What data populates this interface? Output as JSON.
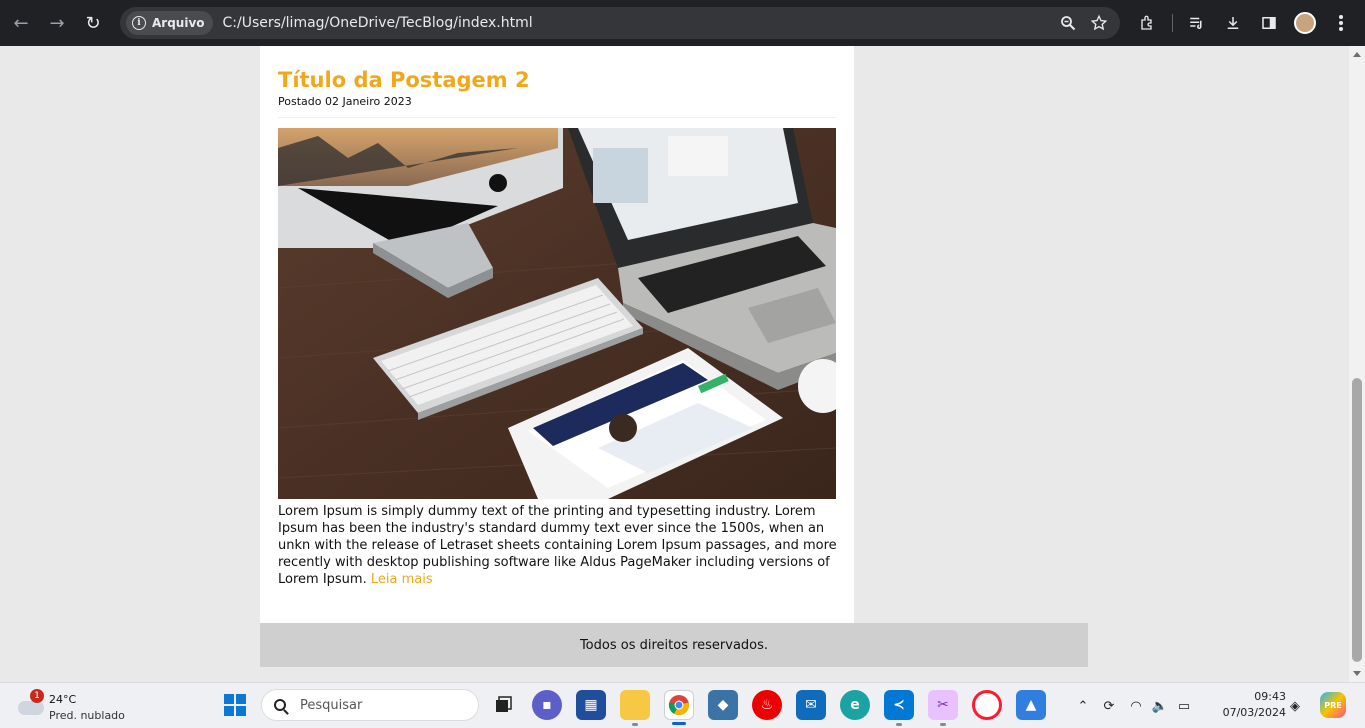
{
  "browser": {
    "nav": {
      "back": "←",
      "forward": "→",
      "reload": "↻"
    },
    "chip_label": "Arquivo",
    "url": "C:/Users/limag/OneDrive/TecBlog/index.html",
    "icons": [
      "zoom-icon",
      "bookmark-star-icon",
      "extensions-icon",
      "reading-list-icon",
      "download-icon",
      "side-panel-icon",
      "profile-avatar",
      "menu-kebab-icon"
    ]
  },
  "post": {
    "title": "Título da Postagem 2",
    "date": "Postado 02 Janeiro 2023",
    "image_alt": "Desk with iMac, MacBook, keyboard and tablet",
    "body": "Lorem Ipsum is simply dummy text of the printing and typesetting industry. Lorem Ipsum has been the industry's standard dummy text ever since the 1500s, when an unkn with the release of Letraset sheets containing Lorem Ipsum passages, and more recently with desktop publishing software like Aldus PageMaker including versions of Lorem Ipsum.",
    "read_more": "Leia mais"
  },
  "footer": {
    "text": "Todos os direitos reservados."
  },
  "colors": {
    "accent": "#f0a81a",
    "browser_bar": "#202124",
    "page_bg": "#e9e9e9",
    "footer_bg": "#cfcfcf"
  },
  "taskbar": {
    "weather": {
      "badge": "1",
      "temp": "24°C",
      "desc": "Pred. nublado"
    },
    "search_placeholder": "Pesquisar",
    "apps": [
      "task-view",
      "copilot-chat",
      "microsoft-store",
      "file-explorer",
      "chrome",
      "python",
      "santander",
      "mail",
      "edge",
      "vscode",
      "snipping-tool",
      "opera",
      "photos"
    ],
    "clock": {
      "time": "09:43",
      "date": "07/03/2024"
    }
  }
}
